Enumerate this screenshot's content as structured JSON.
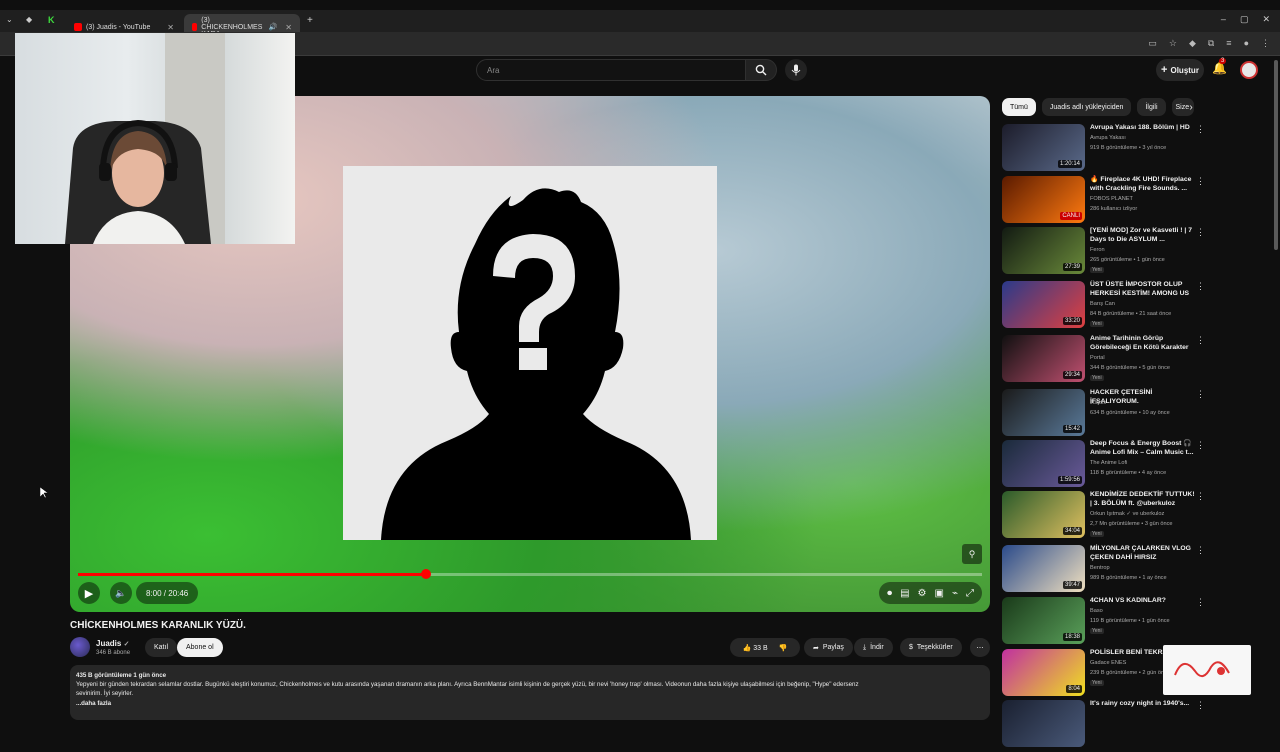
{
  "browser": {
    "tabs": [
      {
        "title": "(3) Juadis - YouTube"
      },
      {
        "title": "(3) CHICKENHOLMES KARA"
      }
    ]
  },
  "search": {
    "placeholder": "Ara"
  },
  "header": {
    "create_label": "Oluştur",
    "notif_count": "3"
  },
  "player": {
    "time": "8:00 / 20:46",
    "progress": 0.385
  },
  "video": {
    "title": "CHİCKENHOLMES KARANLIK YÜZÜ.",
    "channel": "Juadis",
    "subscribers": "346 B abone",
    "join_label": "Katıl",
    "subscribe_label": "Abone ol",
    "likes": "33 B",
    "share_label": "Paylaş",
    "download_label": "İndir",
    "thanks_label": "Teşekkürler",
    "stats": "435 B görüntüleme  1 gün önce",
    "desc_line1": "Yepyeni bir günden tekrardan selamlar dostlar. Bugünkü eleştiri konumuz, Chickenholmes ve kutu arasında yaşanan dramanın arka planı. Ayrıca BennMantar isimli kişinin de gerçek yüzü, bir nevi 'honey trap' olması. Videonun daha fazla kişiye ulaşabilmesi için beğenip, \"Hype\" edersenz",
    "desc_line2": "sevinirim. İyi seyirler.",
    "more_label": "...daha fazla"
  },
  "chips": [
    "Tümü",
    "Juadis adlı yükleyiciden",
    "İlgili",
    "Size"
  ],
  "recs": [
    {
      "title": "Avrupa Yakası 188. Bölüm | HD",
      "channel": "Avrupa Yakası",
      "stats": "919 B görüntüleme • 3 yıl önce",
      "duration": "1:20:14",
      "badge": ""
    },
    {
      "title": "🔥 Fireplace 4K UHD! Fireplace with Crackling Fire Sounds. ...",
      "channel": "FOBOS PLANET",
      "stats": "286 kullanıcı izliyor",
      "duration": "CANLI",
      "badge": ""
    },
    {
      "title": "[YENİ MOD] Zor ve Kasvetli ! | 7 Days to Die ASYLUM ...",
      "channel": "Feron",
      "stats": "265 görüntüleme • 1 gün önce",
      "duration": "27:39",
      "badge": "Yeni"
    },
    {
      "title": "ÜST ÜSTE İMPOSTOR OLUP HERKESİ KESTİM! AMONG US",
      "channel": "Barış Can",
      "stats": "84 B görüntüleme • 21 saat önce",
      "duration": "33:20",
      "badge": "Yeni"
    },
    {
      "title": "Anime Tarihinin Görüp Görebileceği En Kötü Karakter",
      "channel": "Portal",
      "stats": "344 B görüntüleme • 5 gün önce",
      "duration": "29:34",
      "badge": "Yeni"
    },
    {
      "title": "HACKER ÇETESİNİ İFŞALIYORUM.",
      "channel": "Juadis",
      "stats": "634 B görüntüleme • 10 ay önce",
      "duration": "15:42",
      "badge": ""
    },
    {
      "title": "Deep Focus & Energy Boost 🎧 Anime Lofi Mix – Calm Music t...",
      "channel": "The Anime Lofi",
      "stats": "118 B görüntüleme • 4 ay önce",
      "duration": "1:59:56",
      "badge": ""
    },
    {
      "title": "KENDİMİZE DEDEKTİF TUTTUK! | 3. BÖLÜM ft. @uberkuloz",
      "channel": "Orkun Işıtmak ✓ ve uberkuloz",
      "stats": "2,7 Mn görüntüleme • 3 gün önce",
      "duration": "34:04",
      "badge": "Yeni"
    },
    {
      "title": "MİLYONLAR ÇALARKEN VLOG ÇEKEN DAHİ HIRSIZ",
      "channel": "Bentrop",
      "stats": "989 B görüntüleme • 1 ay önce",
      "duration": "39:47",
      "badge": ""
    },
    {
      "title": "4CHAN VS KADINLAR?",
      "channel": "Baso",
      "stats": "119 B görüntüleme • 1 gün önce",
      "duration": "18:38",
      "badge": "Yeni"
    },
    {
      "title": "POLİSLER BENİ TEKRAR...",
      "channel": "Gadace ENES",
      "stats": "239 B görüntüleme • 2 gün önce",
      "duration": "8:04",
      "badge": "Yeni"
    },
    {
      "title": "It's rainy cozy night in 1940's...",
      "channel": "",
      "stats": "",
      "duration": "",
      "badge": ""
    }
  ],
  "colors": {
    "accent": "#ff0000",
    "bg": "#0f0f0f"
  }
}
